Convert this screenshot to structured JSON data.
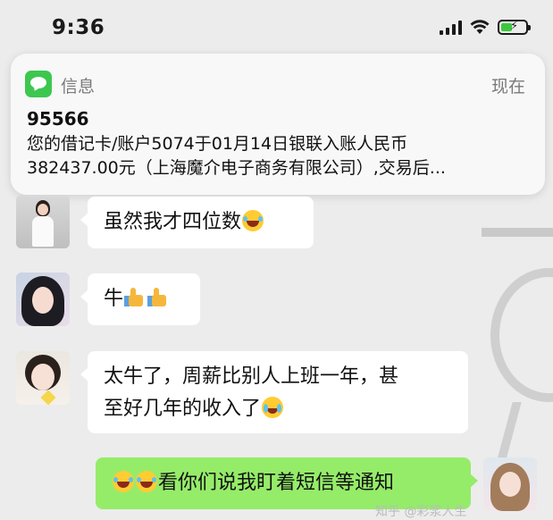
{
  "status_bar": {
    "time": "9:36"
  },
  "notification": {
    "app_name": "信息",
    "timestamp": "现在",
    "sender": "95566",
    "body_line1": "您的借记卡/账户5074于01月14日银联入账人民币",
    "body_line2": "382437.00元（上海魔介电子商务有限公司）,交易后..."
  },
  "chat": {
    "messages": [
      {
        "side": "left",
        "text": "虽然我才四位数",
        "emoji": "laughing-tears"
      },
      {
        "side": "left",
        "text": "牛",
        "emoji": "thumbs-up x2"
      },
      {
        "side": "left",
        "text_line1": "太牛了，周薪比别人上班一年，甚",
        "text_line2": "至好几年的收入了",
        "emoji": "crying-laughing"
      },
      {
        "side": "right",
        "text": "看你们说我盯着短信等通知",
        "emoji": "laughing-tears x2"
      }
    ]
  },
  "watermark": "知乎 @彩浆人生"
}
